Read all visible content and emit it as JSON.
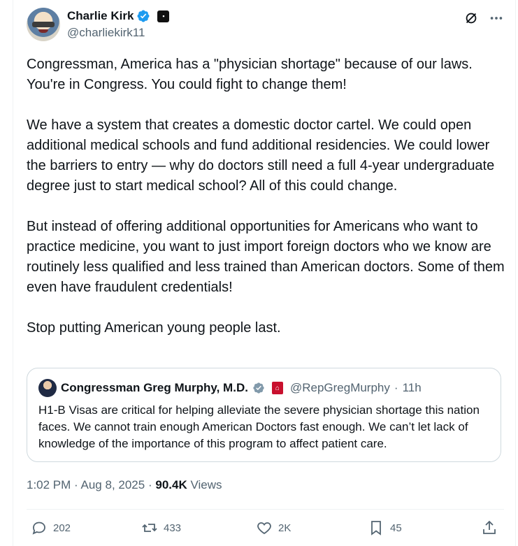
{
  "author": {
    "name": "Charlie Kirk",
    "handle": "@charliekirk11"
  },
  "tweet": {
    "text": "Congressman, America has a \"physician shortage\" because of our laws. You're in Congress. You could fight to change them!\n\nWe have a system that creates a domestic doctor cartel. We could open additional medical schools and fund additional residencies. We could lower the barriers to entry — why do doctors still need a full 4-year undergraduate degree just to start medical school? All of this could change.\n\nBut instead of offering additional opportunities for Americans who want to practice medicine, you want to just import foreign doctors who we know are routinely less qualified and less trained than American doctors. Some of them even have fraudulent credentials!\n\nStop putting American young people last."
  },
  "quote": {
    "name": "Congressman Greg Murphy, M.D.",
    "handle": "@RepGregMurphy",
    "separator": "·",
    "time": "11h",
    "text": "H1-B Visas are critical for helping alleviate the severe physician shortage this nation faces. We cannot train enough American Doctors fast enough. We can’t let lack of knowledge of the importance of this program to affect patient care."
  },
  "meta": {
    "time": "1:02 PM",
    "separator": "·",
    "date": "Aug 8, 2025",
    "views_count": "90.4K",
    "views_label": "Views"
  },
  "actions": {
    "replies": "202",
    "reposts": "433",
    "likes": "2K",
    "bookmarks": "45"
  },
  "colors": {
    "verified": "#1d9bf0",
    "text": "#0f1419",
    "secondary": "#536471",
    "border": "#cfd9de"
  },
  "icons": [
    "verified-badge-icon",
    "grok-icon",
    "more-icon",
    "reply-icon",
    "repost-icon",
    "like-icon",
    "bookmark-icon",
    "share-icon"
  ]
}
